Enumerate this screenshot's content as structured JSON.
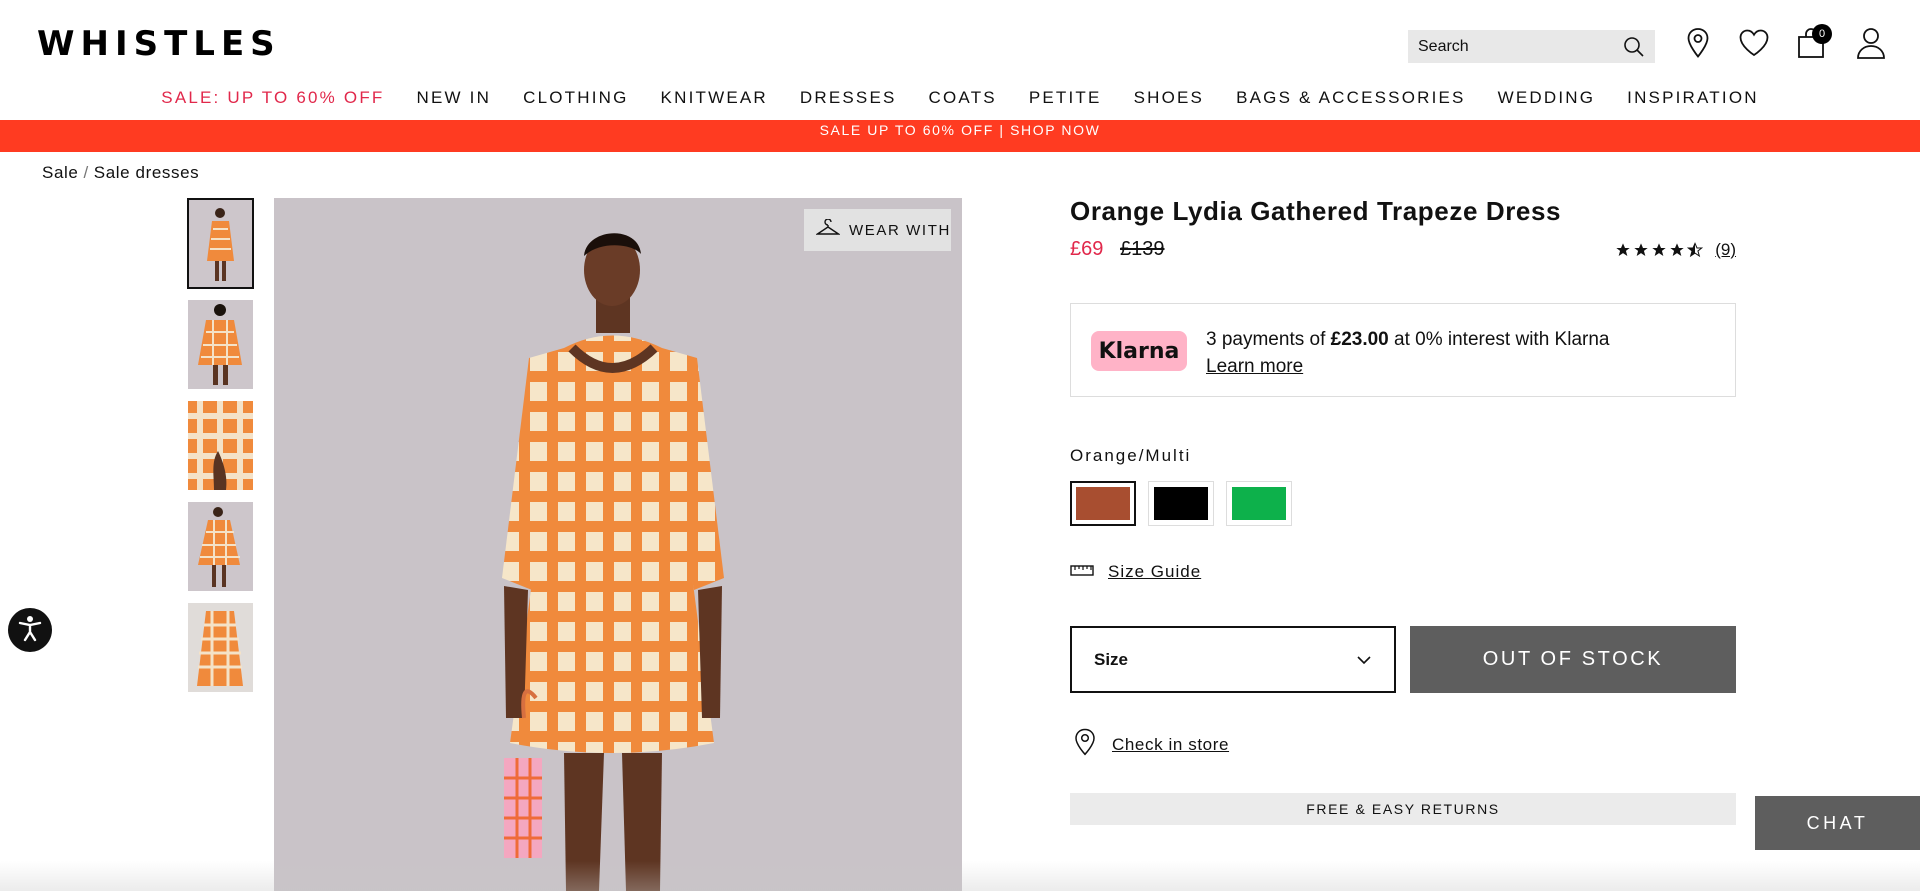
{
  "brand": {
    "logo_text": "WHISTLES"
  },
  "search": {
    "placeholder": "Search"
  },
  "header_icons": {
    "bag_count": "0"
  },
  "nav": [
    {
      "label": "SALE: UP TO 60% OFF"
    },
    {
      "label": "NEW IN"
    },
    {
      "label": "CLOTHING"
    },
    {
      "label": "KNITWEAR"
    },
    {
      "label": "DRESSES"
    },
    {
      "label": "COATS"
    },
    {
      "label": "PETITE"
    },
    {
      "label": "SHOES"
    },
    {
      "label": "BAGS & ACCESSORIES"
    },
    {
      "label": "WEDDING"
    },
    {
      "label": "INSPIRATION"
    }
  ],
  "promo_banner": "SALE UP TO 60% OFF | SHOP NOW",
  "breadcrumb": {
    "items": [
      "Sale",
      "Sale dresses"
    ],
    "separator": "/"
  },
  "gallery": {
    "wear_with_label": "WEAR WITH",
    "thumbnail_count": 5,
    "active_thumbnail": 1
  },
  "product": {
    "title": "Orange Lydia Gathered Trapeze Dress",
    "price_now": "£69",
    "price_was": "£139",
    "rating_value": 4.5,
    "review_count": "(9)",
    "klarna": {
      "logo": "Klarna",
      "prefix": "3 payments of ",
      "amount": "£23.00",
      "suffix": " at 0% interest with Klarna",
      "link": "Learn more"
    },
    "colour_label": "Orange/Multi",
    "colours": [
      {
        "name": "orange",
        "hex": "#a84e30",
        "selected": true
      },
      {
        "name": "black",
        "hex": "#000000",
        "selected": false
      },
      {
        "name": "green",
        "hex": "#0db14b",
        "selected": false
      }
    ],
    "size_guide_label": "Size Guide",
    "size_select_label": "Size",
    "out_of_stock_label": "OUT OF STOCK",
    "check_in_store_label": "Check in store",
    "returns_label": "FREE & EASY RETURNS"
  },
  "chat_label": "CHAT",
  "colors": {
    "sale_red": "#e1284b",
    "banner": "#ff3b21",
    "button_grey": "#5e5e5e",
    "klarna_pink": "#ffb3c7"
  }
}
